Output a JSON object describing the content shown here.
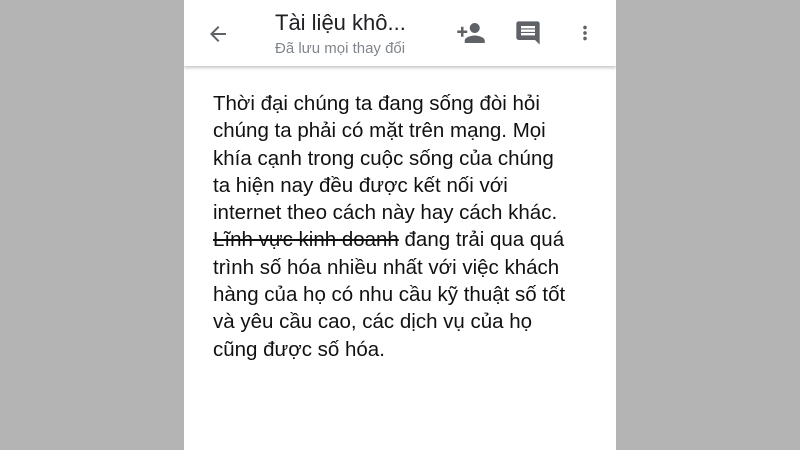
{
  "colors": {
    "outer_background": "#b4b4b4",
    "page_background": "#ffffff",
    "icon_color": "#5f6368",
    "title_color": "#202124",
    "status_color": "#80868b",
    "body_text_color": "#111111"
  },
  "toolbar": {
    "back_icon": "arrow-back-icon",
    "title": "Tài liệu khô...",
    "status": "Đã lưu mọi thay đổi",
    "actions": [
      {
        "name": "add-person-button",
        "icon": "person-add-icon"
      },
      {
        "name": "comment-button",
        "icon": "comment-icon"
      },
      {
        "name": "more-options-button",
        "icon": "more-vert-icon"
      }
    ]
  },
  "document": {
    "lines": [
      {
        "text": "Thời đại chúng ta đang sống đòi hỏi"
      },
      {
        "text": "chúng ta phải có mặt trên mạng. Mọi"
      },
      {
        "text": "khía cạnh trong cuộc sống của chúng"
      },
      {
        "text": "ta hiện nay đều được kết nối với"
      },
      {
        "text": "internet theo cách này hay cách khác."
      },
      {
        "struck": "Lĩnh vực kinh doanh",
        "text": " đang trải qua quá"
      },
      {
        "text": "trình số hóa nhiều nhất với việc khách"
      },
      {
        "text": "hàng của họ có nhu cầu kỹ thuật số tốt"
      },
      {
        "text": "và yêu cầu cao, các dịch vụ của họ"
      },
      {
        "text": "cũng được số hóa."
      }
    ]
  }
}
